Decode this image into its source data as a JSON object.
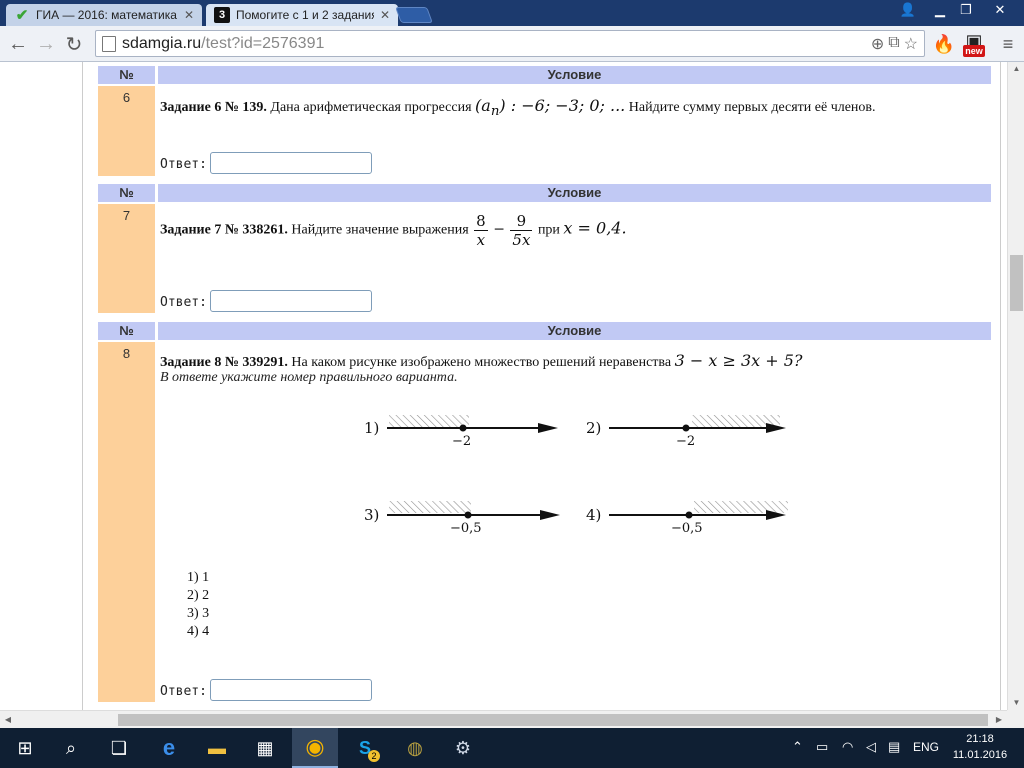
{
  "browser": {
    "tabs": [
      {
        "title": "ГИА — 2016: математика,",
        "icon": "check-icon",
        "active": false
      },
      {
        "title": "Помогите с 1 и 2 задания",
        "icon": "znanija-icon",
        "active": true
      }
    ],
    "url_host": "sdamgia.ru",
    "url_path": "/test?id=2576391",
    "extension_badge": "new"
  },
  "page": {
    "col_num": "№",
    "col_condition": "Условие",
    "answer_label": "Ответ:",
    "tasks": [
      {
        "num": "6",
        "title": "Задание 6 № 139.",
        "text": "Дана арифметическая прогрессия",
        "formula_a": "(a",
        "formula_sub": "n",
        "formula_b": ") : −6; −3; 0; ...",
        "text2": "Найдите сумму первых десяти её членов."
      },
      {
        "num": "7",
        "title": "Задание 7 № 338261.",
        "text": "Найдите значение выражения",
        "frac1_num": "8",
        "frac1_den": "x",
        "minus": "−",
        "frac2_num": "9",
        "frac2_den": "5x",
        "text2": "при",
        "condition": "x = 0,4."
      },
      {
        "num": "8",
        "title": "Задание 8 № 339291.",
        "text": "На каком рисунке изображено множество решений неравенства",
        "inequality": "3 − x ≥ 3x + 5?",
        "hint": "В ответе укажите номер правильного варианта.",
        "figures": [
          {
            "label": "1)",
            "point": "−2"
          },
          {
            "label": "2)",
            "point": "−2"
          },
          {
            "label": "3)",
            "point": "−0,5"
          },
          {
            "label": "4)",
            "point": "−0,5"
          }
        ],
        "options": [
          "1) 1",
          "2) 2",
          "3) 3",
          "4) 4"
        ]
      }
    ]
  },
  "taskbar": {
    "language": "ENG",
    "time": "21:18",
    "date": "11.01.2016",
    "skype_badge": "2"
  },
  "colors": {
    "header_bg": "#c1c9f4",
    "number_cell_bg": "#fdd09a",
    "titlebar": "#1c3a6e",
    "taskbar": "#0f1f33"
  }
}
